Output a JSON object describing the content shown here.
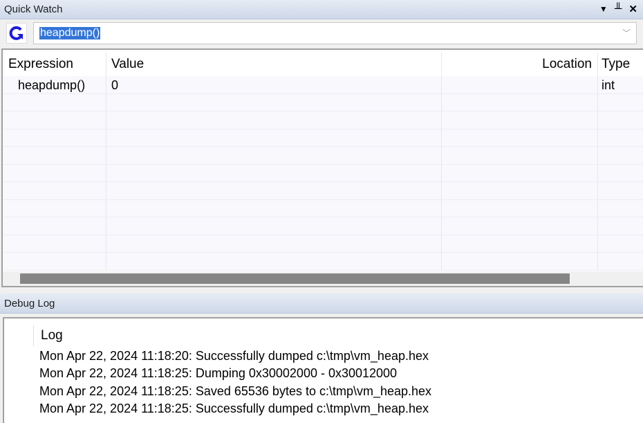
{
  "quick_watch": {
    "title": "Quick Watch",
    "icons": [
      "dropdown-icon",
      "pin-icon",
      "close-icon"
    ],
    "expression_input": "heapdump()",
    "columns": [
      "Expression",
      "Value",
      "Location",
      "Type"
    ],
    "rows": [
      {
        "expression": "heapdump()",
        "value": "0",
        "location": "",
        "type": "int"
      }
    ]
  },
  "debug_log": {
    "title": "Debug Log",
    "column": "Log",
    "lines": [
      "Mon Apr 22, 2024 11:18:20: Successfully dumped c:\\tmp\\vm_heap.hex",
      "Mon Apr 22, 2024 11:18:25: Dumping 0x30002000 - 0x30012000",
      "Mon Apr 22, 2024 11:18:25: Saved 65536 bytes to c:\\tmp\\vm_heap.hex",
      "Mon Apr 22, 2024 11:18:25: Successfully dumped c:\\tmp\\vm_heap.hex"
    ]
  }
}
